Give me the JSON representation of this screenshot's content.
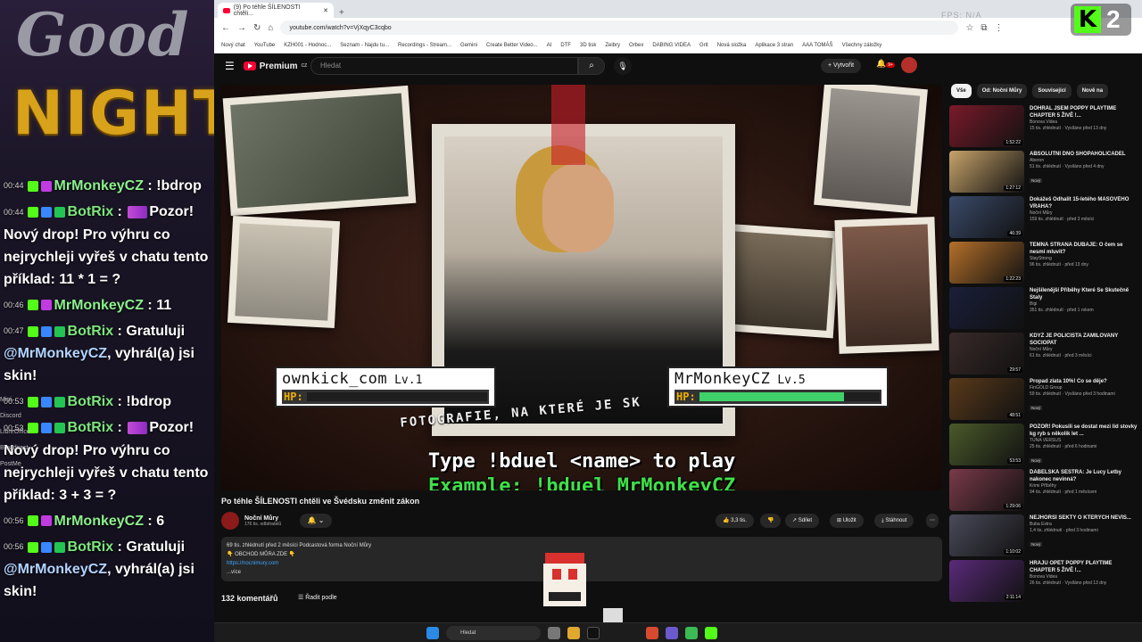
{
  "overlay": {
    "logo_good": "Good",
    "logo_night": "NIGHT",
    "stats_text": "FPS: N/A",
    "kick_count": "2",
    "side_dock": [
      "Mini",
      "Discord",
      "LibreOffice",
      "Broadcast",
      "PostMe"
    ]
  },
  "chat": [
    {
      "time": "00:44",
      "user": "MrMonkeyCZ",
      "text": "!bdrop",
      "type": "monkey"
    },
    {
      "time": "00:44",
      "user": "BotRix",
      "text": "Pozor! Nový drop! Pro výhru co nejrychleji vyřeš v chatu tento příklad: 11 * 1 = ?",
      "type": "bot"
    },
    {
      "time": "00:46",
      "user": "MrMonkeyCZ",
      "text": "11",
      "type": "monkey"
    },
    {
      "time": "00:47",
      "user": "BotRix",
      "text": "Gratuluji",
      "mention": "@MrMonkeyCZ",
      "tail": ", vyhrál(a) jsi skin!",
      "type": "botwin"
    },
    {
      "time": "00:53",
      "user": "BotRix",
      "text": "!bdrop",
      "type": "bot"
    },
    {
      "time": "00:53",
      "user": "BotRix",
      "text": "Pozor! Nový drop! Pro výhru co nejrychleji vyřeš v chatu tento příklad: 3 + 3 = ?",
      "type": "bot"
    },
    {
      "time": "00:56",
      "user": "MrMonkeyCZ",
      "text": "6",
      "type": "monkey"
    },
    {
      "time": "00:56",
      "user": "BotRix",
      "text": "Gratuluji",
      "mention": "@MrMonkeyCZ",
      "tail": ", vyhrál(a) jsi skin!",
      "type": "botwin"
    }
  ],
  "browser": {
    "tab_title": "(9) Po téhle ŠÍLENOSTI chtěli...",
    "new_tab": "+",
    "url": "youtube.com/watch?v=VjXqyC3cqbo",
    "bookmarks": [
      "Nový chat",
      "YouTube",
      "KZH001 - Hodnoc...",
      "Seznam - Najdu tu...",
      "Recordings - Stream...",
      "Gemini",
      "Create Better Video...",
      "AI",
      "DTF",
      "3D tisk",
      "Zeibry",
      "Orbex",
      "DABING VIDEA",
      "Grit",
      "Nová složka",
      "Aplikace 3 stran",
      "AAA TOMÁŠ",
      "Všechny záložky"
    ]
  },
  "youtube": {
    "logo": "Premium",
    "logo_sup": "CZ",
    "search_placeholder": "Hledat",
    "create_label": "Vytvořit",
    "notif_count": "9+"
  },
  "video": {
    "hp1_name": "ownkick_com",
    "hp1_level": "Lv.1",
    "hp1_fill": 0,
    "hp2_name": "MrMonkeyCZ",
    "hp2_level": "Lv.5",
    "hp2_fill": 0.8,
    "hp_label": "HP:",
    "caption": "FOTOGRAFIE, NA KTERÉ JE SK",
    "overlay_line1": "Type !bduel <name> to play",
    "overlay_line2": "Example: !bduel MrMonkeyCZ",
    "title": "Po téhle ŠÍLENOSTI chtěli ve Švédsku změnit zákon",
    "channel": "Noční Můry",
    "subs": "176 tis. odběratelů",
    "likes": "3,3 tis.",
    "share": "Sdílet",
    "save": "Uložit",
    "download": "Stáhnout",
    "desc_line1": "69 tis. zhlédnutí  před 2 měsíci  Podcastová forma Noční Můry",
    "desc_line2": "👇 OBCHOD MŮRA ZDE 👇",
    "desc_link": "https://nocnimury.com",
    "desc_more": "...více",
    "comments": "132 komentářů",
    "sort": "Řadit podle"
  },
  "chips": [
    "Vše",
    "Od: Noční Můry",
    "Související",
    "Nově na"
  ],
  "recs": [
    {
      "title": "DOHRÁL JSEM POPPY PLAYTIME CHAPTER 5 ŽIVĚ !...",
      "channel": "Bonova Videa",
      "stats": "15 tis. zhlédnutí · Vysíláno před 13 dny",
      "dur": "1:52:22",
      "color": "#7a1a2a",
      "isnew": ""
    },
    {
      "title": "ABSOLUTNÍ DNO SHOPAHOLICADEL",
      "channel": "Aberon",
      "stats": "51 tis. zhlédnutí · Vysíláno před 4 dny",
      "dur": "1:27:12",
      "color": "#c7a36a",
      "isnew": "Nový"
    },
    {
      "title": "Dokážeš Odhalit 15-letého MASOVÉHO VRAHA?",
      "channel": "Noční Můry",
      "stats": "159 tis. zhlédnutí · před 3 měsíci",
      "dur": "46:39",
      "color": "#3a4a6a",
      "isnew": ""
    },
    {
      "title": "TEMNÁ STRANA DUBAJE: O čem se nesmí mluvit?",
      "channel": "StayStrong",
      "stats": "96 tis. zhlédnutí · před 13 dny",
      "dur": "1:22:23",
      "color": "#b5702a",
      "isnew": ""
    },
    {
      "title": "Nejšílenější Příběhy Které Se Skutečně Staly",
      "channel": "Bigi",
      "stats": "351 tis. zhlédnutí · před 1 rokem",
      "dur": "",
      "color": "#1a1f3a",
      "isnew": ""
    },
    {
      "title": "KDYŽ JE POLICISTA ZAMILOVANÝ SOCIOPAT",
      "channel": "Noční Můry",
      "stats": "61 tis. zhlédnutí · před 3 měsíci",
      "dur": "29:57",
      "color": "#3a2a2a",
      "isnew": ""
    },
    {
      "title": "Propad zlata 10%! Co se děje?",
      "channel": "FinGOLD Group",
      "stats": "59 tis. zhlédnutí · Vysíláno před 3 hodinami",
      "dur": "48:51",
      "color": "#5a3a1a",
      "isnew": "Nový"
    },
    {
      "title": "POZOR! Pokusili se dostat mezi líd stovky kg ryb s několik let ...",
      "channel": "TUNA VERSUS",
      "stats": "25 tis. zhlédnutí · před 6 hodinami",
      "dur": "53:53",
      "color": "#4a5a2a",
      "isnew": "Nový"
    },
    {
      "title": "ĎÁBELSKÁ SESTRA: Je Lucy Letby nakonec nevinná?",
      "channel": "Krimi Příběhy",
      "stats": "94 tis. zhlédnutí · před 1 měsícem",
      "dur": "1:29:06",
      "color": "#7a3a4a",
      "isnew": ""
    },
    {
      "title": "NEJHORŠÍ SEKTY O KTERÝCH NEVÍŠ...",
      "channel": "Buba Extra",
      "stats": "1,4 tis. zhlédnutí · před 3 hodinami",
      "dur": "1:10:02",
      "color": "#4a4a5a",
      "isnew": "Nový"
    },
    {
      "title": "HRAJU OPĚT POPPY PLAYTIME CHAPTER 5 ŽIVĚ !...",
      "channel": "Bonova Videa",
      "stats": "26 tis. zhlédnutí · Vysíláno před 13 dny",
      "dur": "2:11:14",
      "color": "#5a2a7a",
      "isnew": ""
    }
  ],
  "taskbar": {
    "search": "Hledat"
  }
}
